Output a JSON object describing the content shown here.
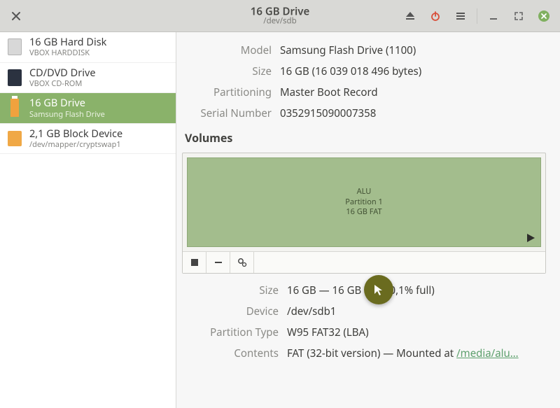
{
  "titlebar": {
    "title": "16 GB Drive",
    "subtitle": "/dev/sdb"
  },
  "sidebar": {
    "items": [
      {
        "name": "16 GB Hard Disk",
        "sub": "VBOX HARDDISK"
      },
      {
        "name": "CD/DVD Drive",
        "sub": "VBOX CD-ROM"
      },
      {
        "name": "16 GB Drive",
        "sub": "Samsung Flash Drive"
      },
      {
        "name": "2,1 GB Block Device",
        "sub": "/dev/mapper/cryptswap1"
      }
    ]
  },
  "info": {
    "model_label": "Model",
    "model": "Samsung Flash Drive (1100)",
    "size_label": "Size",
    "size": "16 GB (16 039 018 496 bytes)",
    "part_label": "Partitioning",
    "part": "Master Boot Record",
    "serial_label": "Serial Number",
    "serial": "0352915090007358"
  },
  "volumes": {
    "heading": "Volumes",
    "partition": {
      "title": "ALU",
      "line2": "Partition 1",
      "line3": "16 GB FAT"
    },
    "details": {
      "size_label": "Size",
      "size": "16 GB — 16 GB free (0,1% full)",
      "device_label": "Device",
      "device": "/dev/sdb1",
      "ptype_label": "Partition Type",
      "ptype": "W95 FAT32 (LBA)",
      "contents_label": "Contents",
      "contents_prefix": "FAT (32-bit version) — Mounted at ",
      "contents_link": "/media/alu…"
    }
  }
}
